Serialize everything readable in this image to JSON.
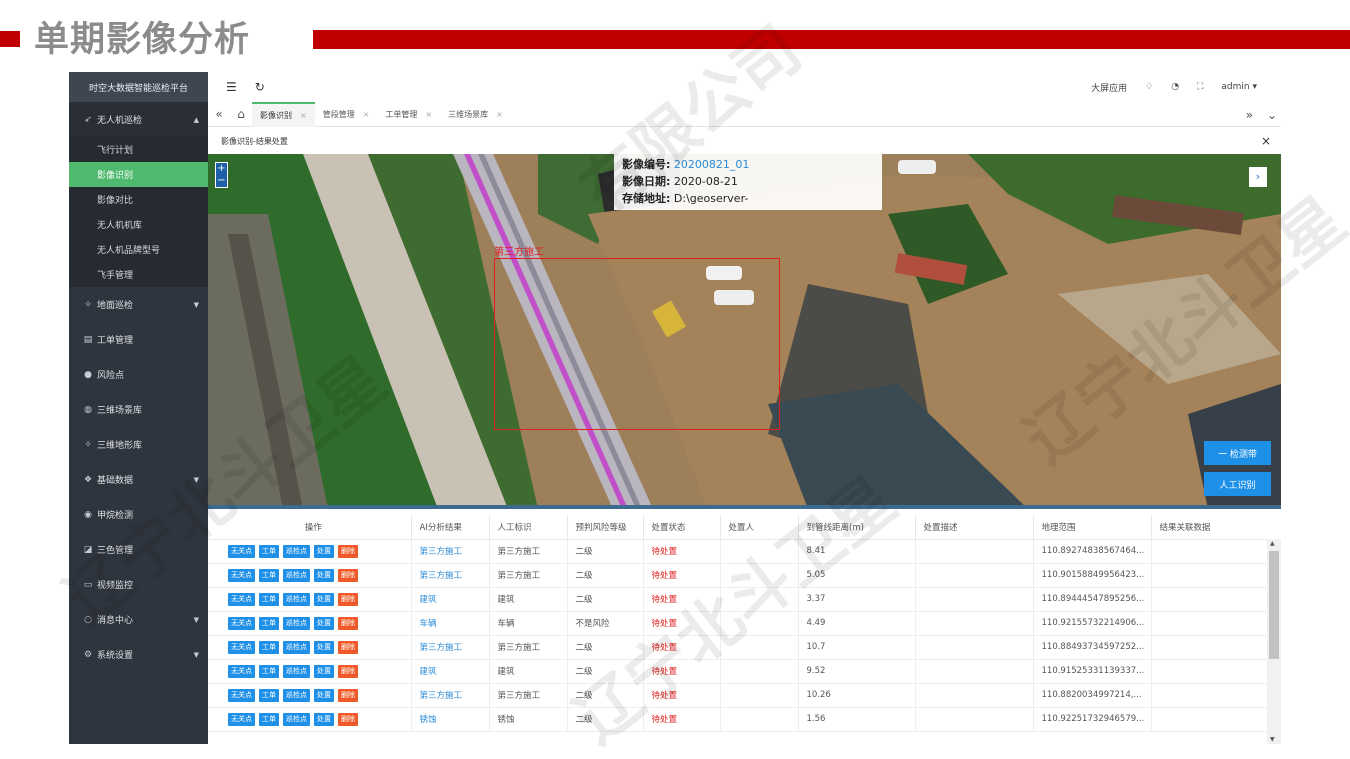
{
  "slide": {
    "title": "单期影像分析"
  },
  "app": {
    "brand": "时空大数据智能巡检平台",
    "topbar": {
      "menu_icon": "☰",
      "refresh_icon": "↻",
      "big_screen": "大屏应用",
      "bell": "♢",
      "chat": "◔",
      "fullscreen": "⛶",
      "user": "admin ▾"
    },
    "sidebar": {
      "uav": "无人机巡检",
      "uav_items": [
        "飞行计划",
        "影像识别",
        "影像对比",
        "无人机机库",
        "无人机品牌型号",
        "飞手管理"
      ],
      "items": [
        {
          "label": "地面巡检",
          "icon": "✧",
          "caret": "▼"
        },
        {
          "label": "工单管理",
          "icon": "▤",
          "caret": ""
        },
        {
          "label": "风险点",
          "icon": "●",
          "caret": ""
        },
        {
          "label": "三维场景库",
          "icon": "◍",
          "caret": ""
        },
        {
          "label": "三维地形库",
          "icon": "✧",
          "caret": ""
        },
        {
          "label": "基础数据",
          "icon": "❖",
          "caret": "▼"
        },
        {
          "label": "甲烷检测",
          "icon": "◉",
          "caret": ""
        },
        {
          "label": "三色管理",
          "icon": "◪",
          "caret": ""
        },
        {
          "label": "视频监控",
          "icon": "▭",
          "caret": ""
        },
        {
          "label": "消息中心",
          "icon": "○",
          "caret": "▼"
        },
        {
          "label": "系统设置",
          "icon": "⚙",
          "caret": "▼"
        }
      ]
    },
    "tabs": [
      "影像识别",
      "管段管理",
      "工单管理",
      "三维场景库"
    ],
    "breadcrumb": "影像识别-结果处置",
    "map": {
      "info_code_label": "影像编号:",
      "info_code": "20200821_01",
      "info_date_label": "影像日期:",
      "info_date": "2020-08-21",
      "info_path_label": "存储地址:",
      "info_path": "D:\\geoserver-",
      "detect_label": "第三方施工",
      "zone_button": "一 检测带",
      "manual_button": "人工识别"
    },
    "table": {
      "headers": [
        "操作",
        "AI分析结果",
        "人工标识",
        "预判风险等级",
        "处置状态",
        "处置人",
        "到管线距离(m)",
        "处置描述",
        "地理范围",
        "结果关联数据"
      ],
      "ops": [
        "无关点",
        "工单",
        "巡检点",
        "处置",
        "删除"
      ],
      "rows": [
        [
          "第三方施工",
          "第三方施工",
          "二级",
          "待处置",
          "",
          "8.41",
          "",
          "110.89274838567464..."
        ],
        [
          "第三方施工",
          "第三方施工",
          "二级",
          "待处置",
          "",
          "5.05",
          "",
          "110.90158849956423..."
        ],
        [
          "建筑",
          "建筑",
          "二级",
          "待处置",
          "",
          "3.37",
          "",
          "110.89444547895256..."
        ],
        [
          "车辆",
          "车辆",
          "不是风险",
          "待处置",
          "",
          "4.49",
          "",
          "110.92155732214906..."
        ],
        [
          "第三方施工",
          "第三方施工",
          "二级",
          "待处置",
          "",
          "10.7",
          "",
          "110.88493734597252..."
        ],
        [
          "建筑",
          "建筑",
          "二级",
          "待处置",
          "",
          "9.52",
          "",
          "110.91525331139337..."
        ],
        [
          "第三方施工",
          "第三方施工",
          "二级",
          "待处置",
          "",
          "10.26",
          "",
          "110.8820034997214,..."
        ],
        [
          "锈蚀",
          "锈蚀",
          "二级",
          "待处置",
          "",
          "1.56",
          "",
          "110.92251732946579..."
        ]
      ]
    }
  },
  "watermark": [
    "辽宁北斗卫星",
    "有限公司",
    "辽宁北斗卫星",
    "辽宁北斗卫星"
  ]
}
